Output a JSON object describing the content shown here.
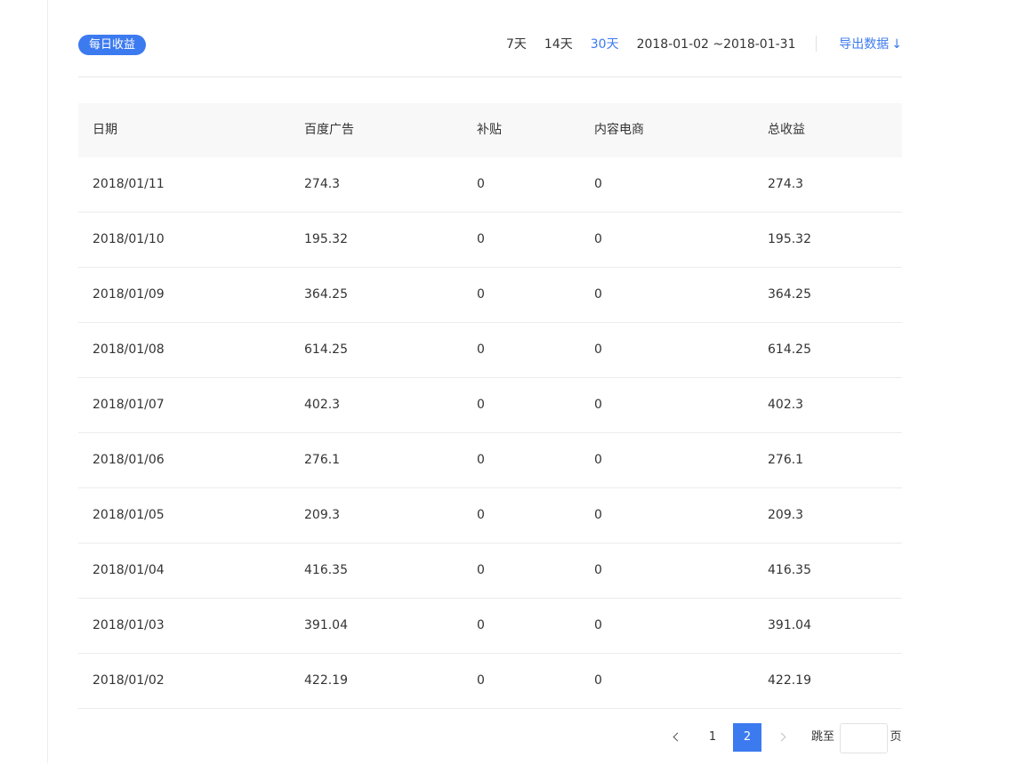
{
  "header": {
    "badge": "每日收益",
    "ranges": [
      {
        "label": "7天",
        "active": false
      },
      {
        "label": "14天",
        "active": false
      },
      {
        "label": "30天",
        "active": true
      }
    ],
    "date_range": "2018-01-02 ~2018-01-31",
    "export_label": "导出数据",
    "export_icon": "arrow-down-icon",
    "accent_color": "#3c7af0"
  },
  "table": {
    "columns": [
      "日期",
      "百度广告",
      "补贴",
      "内容电商",
      "总收益"
    ],
    "rows": [
      [
        "2018/01/11",
        "274.3",
        "0",
        "0",
        "274.3"
      ],
      [
        "2018/01/10",
        "195.32",
        "0",
        "0",
        "195.32"
      ],
      [
        "2018/01/09",
        "364.25",
        "0",
        "0",
        "364.25"
      ],
      [
        "2018/01/08",
        "614.25",
        "0",
        "0",
        "614.25"
      ],
      [
        "2018/01/07",
        "402.3",
        "0",
        "0",
        "402.3"
      ],
      [
        "2018/01/06",
        "276.1",
        "0",
        "0",
        "276.1"
      ],
      [
        "2018/01/05",
        "209.3",
        "0",
        "0",
        "209.3"
      ],
      [
        "2018/01/04",
        "416.35",
        "0",
        "0",
        "416.35"
      ],
      [
        "2018/01/03",
        "391.04",
        "0",
        "0",
        "391.04"
      ],
      [
        "2018/01/02",
        "422.19",
        "0",
        "0",
        "422.19"
      ]
    ]
  },
  "pagination": {
    "pages": [
      "1",
      "2"
    ],
    "current": "2",
    "goto_label": "跳至",
    "unit_label": "页",
    "goto_value": ""
  }
}
